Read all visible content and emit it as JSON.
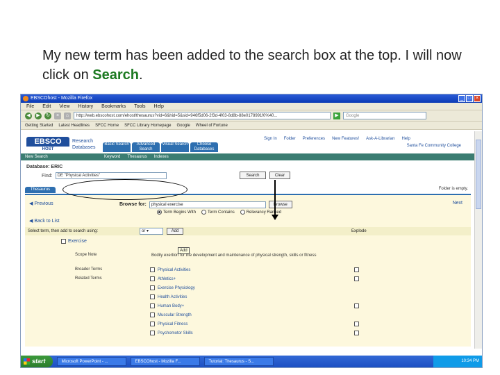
{
  "caption": {
    "part1": "My new term has been added to the search box at the top.  I will now click on ",
    "highlight": "Search",
    "part2": "."
  },
  "browser": {
    "title": "EBSCOhost - Mozilla Firefox",
    "menu": [
      "File",
      "Edit",
      "View",
      "History",
      "Bookmarks",
      "Tools",
      "Help"
    ],
    "url": "http://web.ebscohost.com/ehost/thesaurus?vid=6&hid=5&sid=946f5d06-2f3d-4f03-8d8b-88e0178991f0%40...",
    "search_placeholder": "Google",
    "bookmarks": [
      "Getting Started",
      "Latest Headlines",
      "SFCC Home",
      "SFCC Library Homepage",
      "Google",
      "Wheel of Fortune"
    ]
  },
  "ebsco": {
    "logo_main": "EBSCO",
    "logo_sub": "HOST",
    "research_db": [
      "Research",
      "Databases"
    ],
    "tabs": [
      "Basic Search",
      "Advanced Search",
      "Visual Search",
      "Choose Databases"
    ],
    "top_links": [
      "Sign In",
      "Folder",
      "Preferences",
      "New Features!",
      "Ask-A-Librarian",
      "Help"
    ],
    "university": "Santa Fe Community College",
    "new_search": "New Search",
    "sub_links": [
      "Keyword",
      "Thesaurus",
      "Indexes"
    ],
    "database": "Database: ERIC",
    "find_label": "Find:",
    "find_value": "DE \"Physical Activities\"",
    "search_btn": "Search",
    "clear_btn": "Clear",
    "thesaurus_tab": "Thesaurus",
    "folder_text": "Folder is empty.",
    "previous": "Previous",
    "browse_for": "Browse for:",
    "browse_value": "physical exercise",
    "browse_btn": "Browse",
    "next": "Next",
    "radio_options": [
      "Term Begins With",
      "Term Contains",
      "Relevancy Ranked"
    ],
    "back_to_list": "Back to List",
    "select_label": "Select term, then add to search using:",
    "select_value": "or",
    "add_btn": "Add",
    "explode_label": "Explode",
    "main_term": "Exercise",
    "add_tooltip": "Add",
    "scope_label": "Scope Note",
    "scope_text": "Bodily exertion for the development and maintenance of physical strength, skills or fitness",
    "broader_label": "Broader Terms",
    "related_label": "Related Terms",
    "terms": [
      "Physical Activities",
      "Athletics+",
      "Exercise Physiology",
      "Health Activities",
      "Human Body+",
      "Muscular Strength",
      "Physical Fitness",
      "Psychomotor Skills"
    ]
  },
  "taskbar": {
    "start": "start",
    "tasks": [
      "Microsoft PowerPoint - ...",
      "EBSCOhost - Mozilla F...",
      "Tutorial: Thesaurus - S..."
    ],
    "clock": "10:34 PM"
  }
}
